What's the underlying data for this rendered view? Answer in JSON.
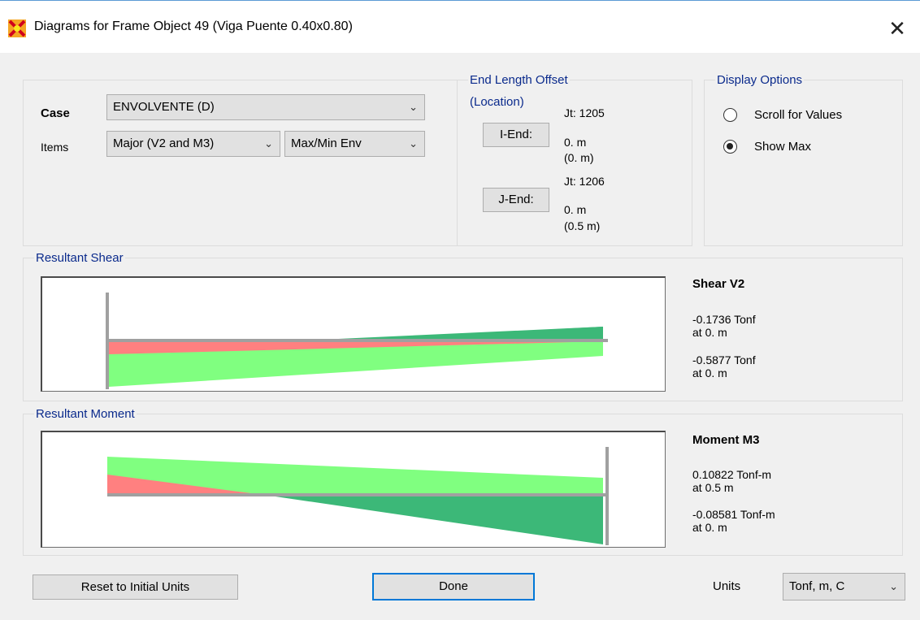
{
  "window": {
    "title": "Diagrams for Frame Object 49  (Viga Puente 0.40x0.80)",
    "close_glyph": "✕"
  },
  "case": {
    "label": "Case",
    "value": "ENVOLVENTE (D)"
  },
  "items": {
    "label": "Items",
    "component": "Major (V2 and M3)",
    "envelope": "Max/Min Env"
  },
  "end_offset": {
    "title": "End Length Offset",
    "subtitle": "(Location)",
    "i_end": {
      "button": "I-End:",
      "joint": "Jt:  1205",
      "length": "0. m",
      "location": "(0. m)"
    },
    "j_end": {
      "button": "J-End:",
      "joint": "Jt:  1206",
      "length": "0. m",
      "location": "(0.5 m)"
    }
  },
  "display_options": {
    "title": "Display Options",
    "options": [
      {
        "label": "Scroll for Values",
        "selected": false
      },
      {
        "label": "Show Max",
        "selected": true
      }
    ]
  },
  "shear": {
    "group_title": "Resultant Shear",
    "heading": "Shear V2",
    "max_value": "-0.1736 Tonf",
    "max_at": "at 0. m",
    "min_value": "-0.5877 Tonf",
    "min_at": "at 0. m"
  },
  "moment": {
    "group_title": "Resultant Moment",
    "heading": "Moment M3",
    "max_value": "0.10822 Tonf-m",
    "max_at": "at 0.5 m",
    "min_value": "-0.08581 Tonf-m",
    "min_at": "at 0. m"
  },
  "footer": {
    "reset_button": "Reset to Initial Units",
    "done_button": "Done",
    "units_label": "Units",
    "units_value": "Tonf, m, C"
  },
  "colors": {
    "max_fill": "#80ff80",
    "min_fill": "#ff8080",
    "overlap_fill": "#3cb878",
    "axis": "#a0a0a0",
    "group_title": "#0a2a8c"
  }
}
